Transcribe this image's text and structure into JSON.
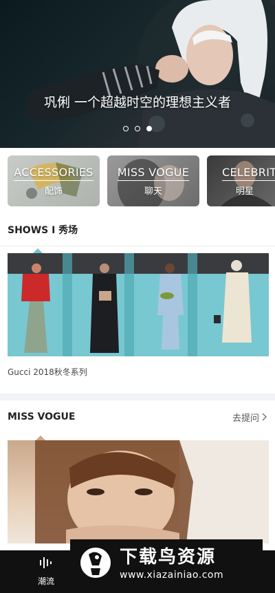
{
  "hero": {
    "caption": "巩俐 一个超越时空的理想主义者",
    "slides": 3,
    "active_slide": 3
  },
  "categories": [
    {
      "title": "ACCESSORIES",
      "sub": "配饰"
    },
    {
      "title": "MISS VOGUE",
      "sub": "聊天"
    },
    {
      "title": "CELEBRIT",
      "sub": "明星"
    }
  ],
  "shows": {
    "header": "SHOWS I 秀场",
    "caption": "Gucci 2018秋冬系列"
  },
  "miss_vogue": {
    "header": "MISS VOGUE",
    "more_label": "去提问"
  },
  "tabbar": {
    "tab1_label": "潮流"
  },
  "watermark": {
    "title": "下载鸟资源",
    "url": "www.xiazainiao.com"
  },
  "colors": {
    "accent": "#111111",
    "background": "#f2f3f5"
  }
}
